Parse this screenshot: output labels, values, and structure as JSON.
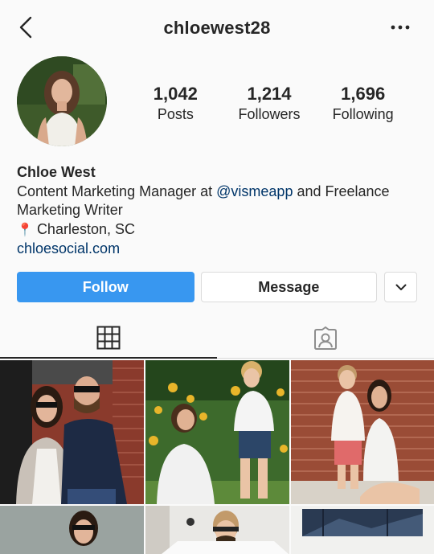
{
  "header": {
    "username": "chloewest28"
  },
  "profile": {
    "stats": [
      {
        "value": "1,042",
        "label": "Posts"
      },
      {
        "value": "1,214",
        "label": "Followers"
      },
      {
        "value": "1,696",
        "label": "Following"
      }
    ],
    "name": "Chloe West",
    "bio_prefix": "Content Marketing Manager at ",
    "bio_mention": "@vismeapp",
    "bio_suffix": " and Freelance Marketing Writer",
    "location_pin": "📍",
    "location": "Charleston, SC",
    "website": "chloesocial.com"
  },
  "actions": {
    "follow_label": "Follow",
    "message_label": "Message"
  },
  "tabs": [
    {
      "icon": "grid-icon",
      "active": true
    },
    {
      "icon": "tagged-icon",
      "active": false
    }
  ],
  "colors": {
    "follow_blue": "#3897f0",
    "link_navy": "#003569",
    "border": "#dbdbdb",
    "background": "#fafafa"
  }
}
